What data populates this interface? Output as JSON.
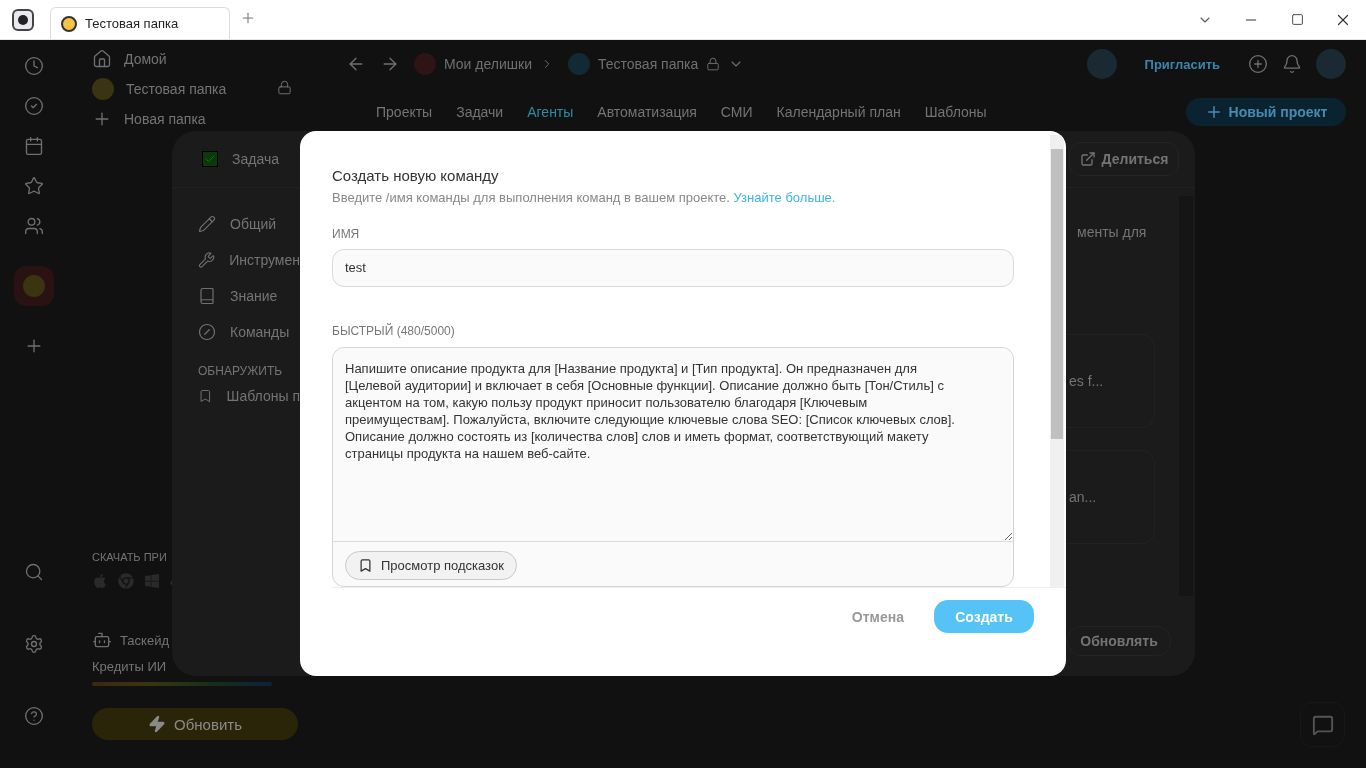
{
  "window": {
    "tabs": [
      {
        "label": "Тестовая папка",
        "selected": true
      }
    ]
  },
  "sidebar": {
    "items": [
      {
        "label": "Домой",
        "kind": "home",
        "locked": false
      },
      {
        "label": "Тестовая папка",
        "kind": "folder",
        "locked": true
      },
      {
        "label": "Новая папка",
        "kind": "add",
        "locked": false
      }
    ],
    "download_heading": "СКАЧАТЬ ПРИ",
    "assistant": "Таскейд",
    "credits_label": "Кредиты ИИ",
    "upgrade_button": "Обновить"
  },
  "header": {
    "breadcrumbs": [
      {
        "label": "Мои делишки",
        "kind": "workspace"
      },
      {
        "label": "Тестовая папка",
        "kind": "folder"
      }
    ],
    "invite": "Пригласить",
    "tabs": [
      {
        "label": "Проекты",
        "selected": false
      },
      {
        "label": "Задачи",
        "selected": false
      },
      {
        "label": "Агенты",
        "selected": true
      },
      {
        "label": "Автоматизация",
        "selected": false
      },
      {
        "label": "СМИ",
        "selected": false
      },
      {
        "label": "Календарный план",
        "selected": false
      },
      {
        "label": "Шаблоны",
        "selected": false
      }
    ],
    "new_project": "Новый проект"
  },
  "panel": {
    "title": "Задача",
    "share": "Делиться",
    "nav": [
      {
        "label": "Общий",
        "kind": "pencil"
      },
      {
        "label": "Инструмен",
        "kind": "wrench"
      },
      {
        "label": "Знание",
        "kind": "book"
      },
      {
        "label": "Команды",
        "kind": "command"
      }
    ],
    "section": "ОБНАРУЖИТЬ",
    "discover": [
      {
        "label": "Шаблоны п",
        "kind": "bookmark"
      }
    ],
    "description": "менты для",
    "cards": [
      "es f...",
      "an..."
    ],
    "update_button": "Обновлять"
  },
  "dialog": {
    "title": "Создать новую команду",
    "subtitle": "Введите /имя команды для выполнения команд в вашем проекте.",
    "link": "Узнайте больше.",
    "name_label": "ИМЯ",
    "name_value": "test",
    "prompt_label": "БЫСТРЫЙ (480/5000)",
    "prompt_value": "Напишите описание продукта для [Название продукта] и [Тип продукта]. Он предназначен для [Целевой аудитории] и включает в себя [Основные функции]. Описание должно быть [Тон/Стиль] с акцентом на том, какую пользу продукт приносит пользователю благодаря [Ключевым преимуществам]. Пожалуйста, включите следующие ключевые слова SEO: [Список ключевых слов]. Описание должно состоять из [количества слов] слов и иметь формат, соответствующий макету страницы продукта на нашем веб-сайте.",
    "hints_button": "Просмотр подсказок",
    "cancel": "Отмена",
    "create": "Создать"
  }
}
